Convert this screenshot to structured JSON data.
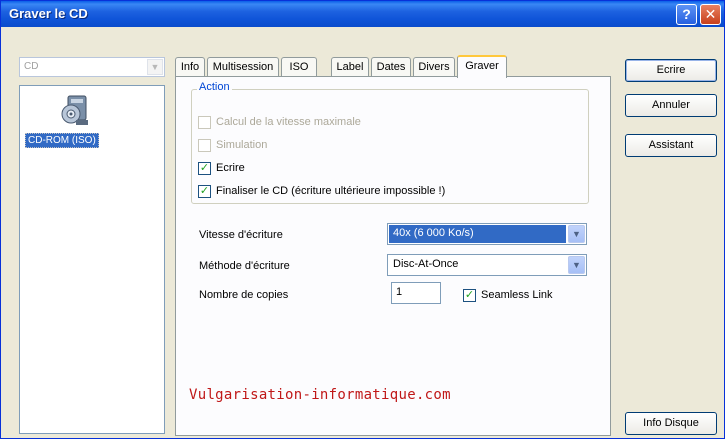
{
  "window": {
    "title": "Graver le CD"
  },
  "titlebar": {
    "help_glyph": "?",
    "close_glyph": "✕"
  },
  "left": {
    "combo_value": "CD",
    "list_item": "CD-ROM (ISO)",
    "icon": "cd-drive-icon"
  },
  "tabs": [
    "Info",
    "Multisession",
    "ISO",
    "Label",
    "Dates",
    "Divers",
    "Graver"
  ],
  "active_tab": "Graver",
  "action": {
    "title": "Action",
    "options": [
      {
        "label": "Calcul de la vitesse maximale",
        "checked": false,
        "enabled": false
      },
      {
        "label": "Simulation",
        "checked": false,
        "enabled": false
      },
      {
        "label": "Ecrire",
        "checked": true,
        "enabled": true
      },
      {
        "label": "Finaliser le CD (écriture ultérieure impossible !)",
        "checked": true,
        "enabled": true
      }
    ]
  },
  "fields": {
    "speed_label": "Vitesse d'écriture",
    "speed_value": "40x (6 000 Ko/s)",
    "method_label": "Méthode d'écriture",
    "method_value": "Disc-At-Once",
    "copies_label": "Nombre de copies",
    "copies_value": "1",
    "seamless_label": "Seamless Link",
    "seamless_checked": true
  },
  "watermark": "Vulgarisation-informatique.com",
  "buttons": {
    "write": "Ecrire",
    "cancel": "Annuler",
    "wizard": "Assistant",
    "disc_info": "Info Disque"
  },
  "colors": {
    "title_bar": "#0f54d8",
    "selection": "#316ac5",
    "watermark": "#c01818"
  }
}
